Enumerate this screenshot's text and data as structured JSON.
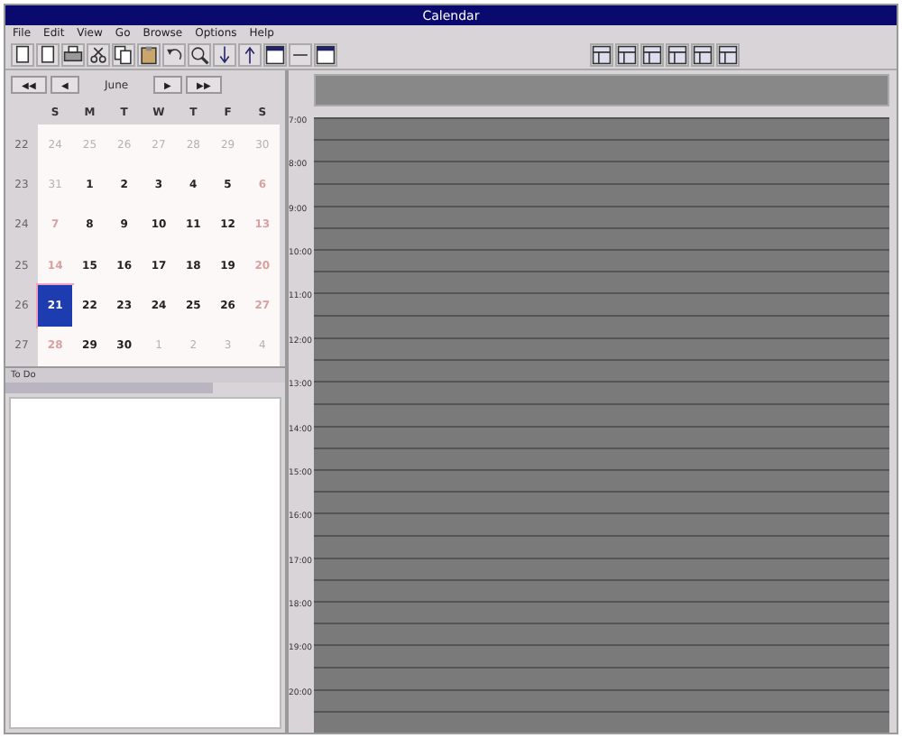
{
  "window": {
    "title": "Calendar"
  },
  "menu": [
    "File",
    "Edit",
    "View",
    "Go",
    "Browse",
    "Options",
    "Help"
  ],
  "toolbar_left": [
    {
      "kind": "doc"
    },
    {
      "kind": "doc"
    },
    {
      "kind": "print"
    },
    {
      "kind": "cut"
    },
    {
      "kind": "copy"
    },
    {
      "kind": "paste"
    },
    {
      "kind": "undo"
    },
    {
      "kind": "search"
    },
    {
      "kind": "down"
    },
    {
      "kind": "up"
    },
    {
      "kind": "window"
    },
    {
      "kind": "minus"
    },
    {
      "kind": "window"
    }
  ],
  "toolbar_right": [
    {
      "kind": "view"
    },
    {
      "kind": "view"
    },
    {
      "kind": "view"
    },
    {
      "kind": "view"
    },
    {
      "kind": "view"
    },
    {
      "kind": "view"
    }
  ],
  "nav": {
    "buttons": [
      {
        "label": "◀◀"
      },
      {
        "label": "◀"
      }
    ],
    "month": "June",
    "next": [
      {
        "label": "▶"
      },
      {
        "label": "▶▶"
      }
    ]
  },
  "calendar": {
    "weekdays": [
      "S",
      "M",
      "T",
      "W",
      "T",
      "F",
      "S"
    ],
    "weeks": [
      {
        "number": "22",
        "days": [
          {
            "day": "24",
            "other": true,
            "selected": false
          },
          {
            "day": "25",
            "other": true,
            "selected": false
          },
          {
            "day": "26",
            "other": true,
            "selected": false
          },
          {
            "day": "27",
            "other": true,
            "selected": false
          },
          {
            "day": "28",
            "other": true,
            "selected": false
          },
          {
            "day": "29",
            "other": true,
            "selected": false
          },
          {
            "day": "30",
            "other": true,
            "selected": false
          }
        ]
      },
      {
        "number": "23",
        "days": [
          {
            "day": "31",
            "other": true,
            "selected": false
          },
          {
            "day": "1",
            "other": false,
            "selected": false
          },
          {
            "day": "2",
            "other": false,
            "selected": false
          },
          {
            "day": "3",
            "other": false,
            "selected": false
          },
          {
            "day": "4",
            "other": false,
            "selected": false
          },
          {
            "day": "5",
            "other": false,
            "selected": false
          },
          {
            "day": "6",
            "other": false,
            "selected": false
          }
        ]
      },
      {
        "number": "24",
        "days": [
          {
            "day": "7",
            "other": false,
            "selected": false
          },
          {
            "day": "8",
            "other": false,
            "selected": false
          },
          {
            "day": "9",
            "other": false,
            "selected": false
          },
          {
            "day": "10",
            "other": false,
            "selected": false
          },
          {
            "day": "11",
            "other": false,
            "selected": false
          },
          {
            "day": "12",
            "other": false,
            "selected": false
          },
          {
            "day": "13",
            "other": false,
            "selected": false
          }
        ]
      },
      {
        "number": "25",
        "days": [
          {
            "day": "14",
            "other": false,
            "selected": false
          },
          {
            "day": "15",
            "other": false,
            "selected": false
          },
          {
            "day": "16",
            "other": false,
            "selected": false
          },
          {
            "day": "17",
            "other": false,
            "selected": false
          },
          {
            "day": "18",
            "other": false,
            "selected": false
          },
          {
            "day": "19",
            "other": false,
            "selected": false
          },
          {
            "day": "20",
            "other": false,
            "selected": false
          }
        ]
      },
      {
        "number": "26",
        "days": [
          {
            "day": "21",
            "other": false,
            "selected": true
          },
          {
            "day": "22",
            "other": false,
            "selected": false
          },
          {
            "day": "23",
            "other": false,
            "selected": false
          },
          {
            "day": "24",
            "other": false,
            "selected": false
          },
          {
            "day": "25",
            "other": false,
            "selected": false
          },
          {
            "day": "26",
            "other": false,
            "selected": false
          },
          {
            "day": "27",
            "other": false,
            "selected": false
          }
        ]
      },
      {
        "number": "27",
        "days": [
          {
            "day": "28",
            "other": false,
            "selected": false
          },
          {
            "day": "29",
            "other": false,
            "selected": false
          },
          {
            "day": "30",
            "other": false,
            "selected": false
          },
          {
            "day": "1",
            "other": true,
            "selected": false
          },
          {
            "day": "2",
            "other": true,
            "selected": false
          },
          {
            "day": "3",
            "other": true,
            "selected": false
          },
          {
            "day": "4",
            "other": true,
            "selected": false
          }
        ]
      }
    ]
  },
  "todo": {
    "title": "To Do"
  },
  "day_view": {
    "hours": [
      "7:00",
      "8:00",
      "9:00",
      "10:00",
      "11:00",
      "12:00",
      "13:00",
      "14:00",
      "15:00",
      "16:00",
      "17:00",
      "18:00",
      "19:00",
      "20:00"
    ]
  }
}
